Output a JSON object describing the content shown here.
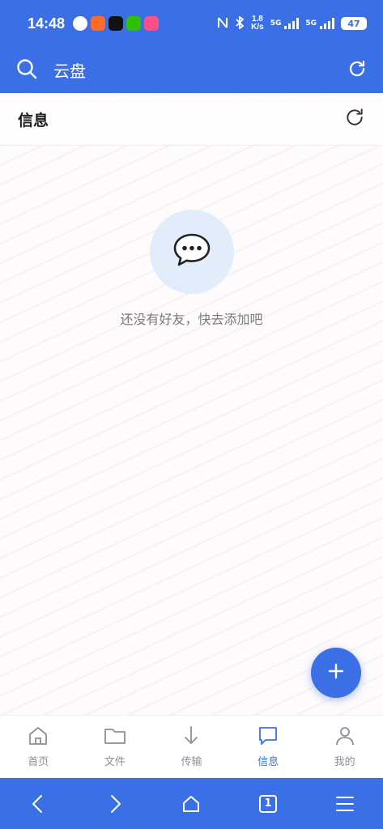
{
  "status": {
    "time": "14:48",
    "speed_value": "1.8",
    "speed_unit": "K/s",
    "net1": "5G",
    "net2": "5G",
    "battery": "47"
  },
  "app_bar": {
    "title": "云盘",
    "search_icon": "search-icon",
    "refresh_icon": "refresh-icon"
  },
  "section": {
    "title": "信息",
    "refresh_icon": "refresh-icon"
  },
  "empty_state": {
    "icon": "chat-bubble-icon",
    "text": "还没有好友，快去添加吧"
  },
  "fab": {
    "icon": "plus-icon"
  },
  "bottom_nav": [
    {
      "label": "首页",
      "icon": "home-icon",
      "active": false
    },
    {
      "label": "文件",
      "icon": "folder-icon",
      "active": false
    },
    {
      "label": "传输",
      "icon": "download-arrow-icon",
      "active": false
    },
    {
      "label": "信息",
      "icon": "message-icon",
      "active": true
    },
    {
      "label": "我的",
      "icon": "user-icon",
      "active": false
    }
  ],
  "system_nav": {
    "tab_count": "1"
  },
  "colors": {
    "primary": "#3b6fe6",
    "inactive": "#8a8f98",
    "empty_circle": "#e3ecfb"
  }
}
